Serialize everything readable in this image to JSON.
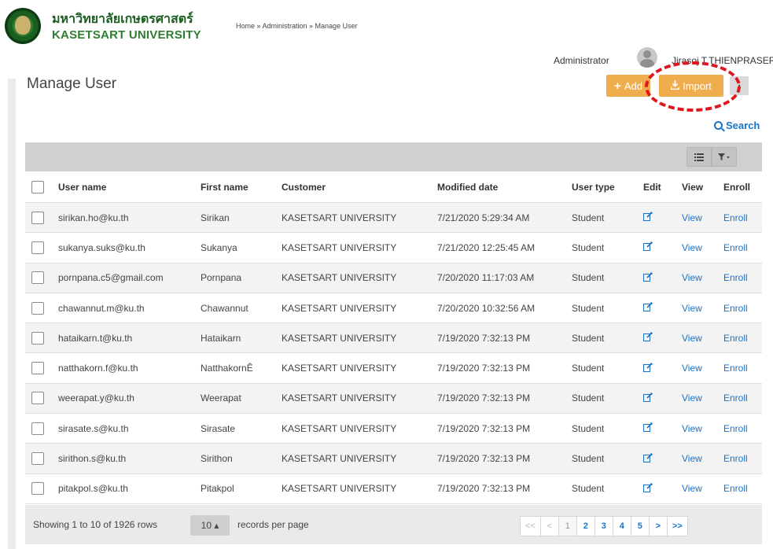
{
  "header": {
    "university_th": "มหาวิทยาลัยเกษตรศาสตร์",
    "university_en": "KASETSART UNIVERSITY",
    "breadcrumb": "Home » Administration » Manage User",
    "role": "Administrator",
    "username": "Jirasoj T.THIENPRASER"
  },
  "page": {
    "title": "Manage User",
    "add_label": "Add",
    "import_label": "Import",
    "more_label": "⋮",
    "search_label": "Search"
  },
  "toolbar": {
    "list_icon": "list-icon",
    "filter_icon": "filter-icon"
  },
  "table": {
    "headers": {
      "user_name": "User name",
      "first_name": "First name",
      "customer": "Customer",
      "modified_date": "Modified date",
      "user_type": "User type",
      "edit": "Edit",
      "view": "View",
      "enroll": "Enroll"
    },
    "rows": [
      {
        "user": "sirikan.ho@ku.th",
        "first": "Sirikan",
        "customer": "KASETSART UNIVERSITY",
        "modified": "7/21/2020 5:29:34 AM",
        "type": "Student",
        "view": "View",
        "enroll": "Enroll"
      },
      {
        "user": "sukanya.suks@ku.th",
        "first": "Sukanya",
        "customer": "KASETSART UNIVERSITY",
        "modified": "7/21/2020 12:25:45 AM",
        "type": "Student",
        "view": "View",
        "enroll": "Enroll"
      },
      {
        "user": "pornpana.c5@gmail.com",
        "first": "Pornpana",
        "customer": "KASETSART UNIVERSITY",
        "modified": "7/20/2020 11:17:03 AM",
        "type": "Student",
        "view": "View",
        "enroll": "Enroll"
      },
      {
        "user": "chawannut.m@ku.th",
        "first": "Chawannut",
        "customer": "KASETSART UNIVERSITY",
        "modified": "7/20/2020 10:32:56 AM",
        "type": "Student",
        "view": "View",
        "enroll": "Enroll"
      },
      {
        "user": "hataikarn.t@ku.th",
        "first": "Hataikarn",
        "customer": "KASETSART UNIVERSITY",
        "modified": "7/19/2020 7:32:13 PM",
        "type": "Student",
        "view": "View",
        "enroll": "Enroll"
      },
      {
        "user": "natthakorn.f@ku.th",
        "first": "NatthakornÊ",
        "customer": "KASETSART UNIVERSITY",
        "modified": "7/19/2020 7:32:13 PM",
        "type": "Student",
        "view": "View",
        "enroll": "Enroll"
      },
      {
        "user": "weerapat.y@ku.th",
        "first": "Weerapat",
        "customer": "KASETSART UNIVERSITY",
        "modified": "7/19/2020 7:32:13 PM",
        "type": "Student",
        "view": "View",
        "enroll": "Enroll"
      },
      {
        "user": "sirasate.s@ku.th",
        "first": "Sirasate",
        "customer": "KASETSART UNIVERSITY",
        "modified": "7/19/2020 7:32:13 PM",
        "type": "Student",
        "view": "View",
        "enroll": "Enroll"
      },
      {
        "user": "sirithon.s@ku.th",
        "first": "Sirithon",
        "customer": "KASETSART UNIVERSITY",
        "modified": "7/19/2020 7:32:13 PM",
        "type": "Student",
        "view": "View",
        "enroll": "Enroll"
      },
      {
        "user": "pitakpol.s@ku.th",
        "first": "Pitakpol",
        "customer": "KASETSART UNIVERSITY",
        "modified": "7/19/2020 7:32:13 PM",
        "type": "Student",
        "view": "View",
        "enroll": "Enroll"
      }
    ]
  },
  "footer": {
    "rows_info": "Showing 1 to 10 of 1926 rows",
    "page_size": "10 ▴",
    "per_page_label": "records per page",
    "pager": [
      "<<",
      "<",
      "1",
      "2",
      "3",
      "4",
      "5",
      ">",
      ">>"
    ]
  },
  "colors": {
    "accent_button": "#f0ad4e",
    "link": "#1a73c9",
    "annotation": "#e0161e"
  }
}
